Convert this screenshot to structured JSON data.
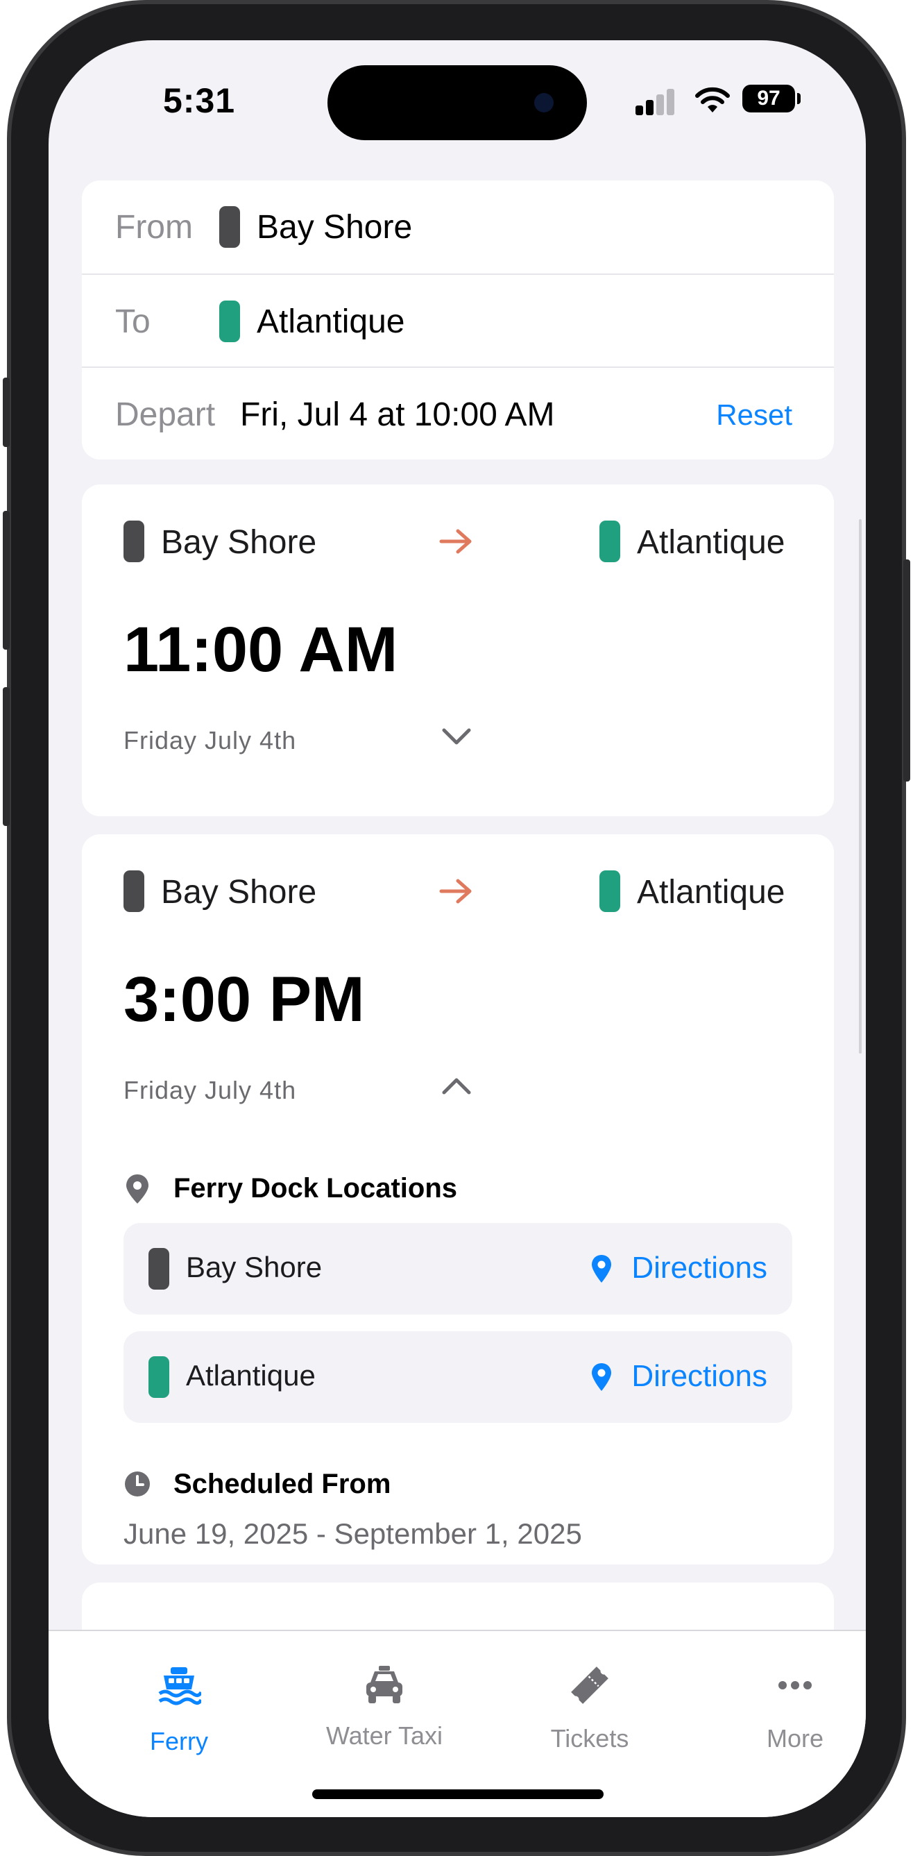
{
  "status_bar": {
    "time": "5:31",
    "battery": "97"
  },
  "search": {
    "from_label": "From",
    "from_value": "Bay Shore",
    "to_label": "To",
    "to_value": "Atlantique",
    "depart_label": "Depart",
    "depart_value": "Fri, Jul 4 at 10:00 AM",
    "reset_label": "Reset"
  },
  "trips": [
    {
      "origin": "Bay Shore",
      "destination": "Atlantique",
      "time": "11:00 AM",
      "date": "Friday July 4th",
      "expanded": false
    },
    {
      "origin": "Bay Shore",
      "destination": "Atlantique",
      "time": "3:00 PM",
      "date": "Friday July 4th",
      "expanded": true,
      "dock_heading": "Ferry Dock Locations",
      "docks": [
        {
          "name": "Bay Shore",
          "action": "Directions"
        },
        {
          "name": "Atlantique",
          "action": "Directions"
        }
      ],
      "schedule_heading": "Scheduled From",
      "schedule_range": "June 19, 2025 - September 1, 2025"
    }
  ],
  "tabs": [
    {
      "label": "Ferry",
      "icon": "ferry-icon",
      "active": true
    },
    {
      "label": "Water Taxi",
      "icon": "car-icon",
      "active": false
    },
    {
      "label": "Tickets",
      "icon": "ticket-icon",
      "active": false
    },
    {
      "label": "More",
      "icon": "more-icon",
      "active": false
    }
  ],
  "colors": {
    "accent": "#0a84ff",
    "origin_pill": "#4a4a4d",
    "destination_pill": "#21a07f",
    "arrow": "#e07a5f"
  }
}
